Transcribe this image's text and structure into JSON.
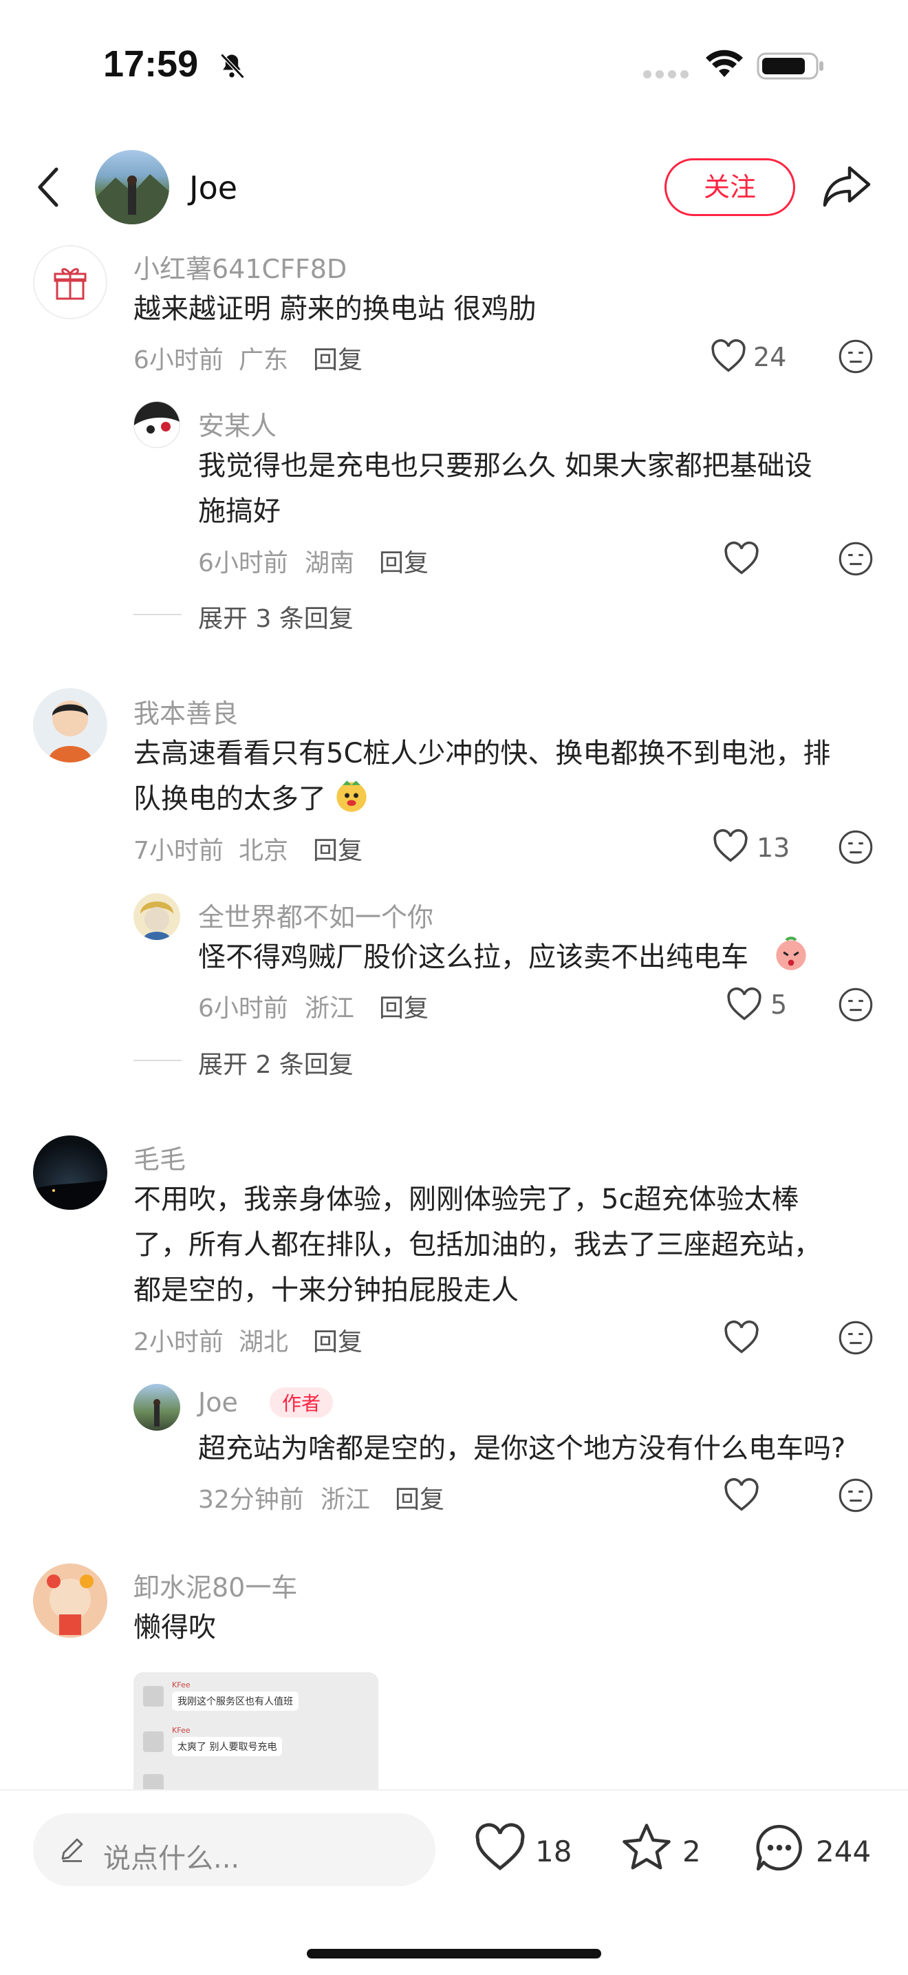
{
  "status": {
    "time": "17:59"
  },
  "header": {
    "name": "Joe",
    "follow_label": "关注"
  },
  "comments": [
    {
      "user": "小红薯641CFF8D",
      "text": "越来越证明 蔚来的换电站 很鸡肋",
      "time": "6小时前",
      "region": "广东",
      "reply_label": "回复",
      "likes": "24",
      "replies": [
        {
          "user": "安某人",
          "text_lines": [
            "我觉得也是充电也只要那么久   如果大家都把基础设",
            "施搞好"
          ],
          "time": "6小时前",
          "region": "湖南",
          "reply_label": "回复",
          "likes": ""
        }
      ],
      "expand": "展开 3 条回复"
    },
    {
      "user": "我本善良",
      "text_lines": [
        "去高速看看只有5C桩人少冲的快、换电都换不到电池，排",
        "队换电的太多了"
      ],
      "time": "7小时前",
      "region": "北京",
      "reply_label": "回复",
      "likes": "13",
      "replies": [
        {
          "user": "全世界都不如一个你",
          "text": "怪不得鸡贼厂股价这么拉，应该卖不出纯电车",
          "time": "6小时前",
          "region": "浙江",
          "reply_label": "回复",
          "likes": "5"
        }
      ],
      "expand": "展开 2 条回复"
    },
    {
      "user": "毛毛",
      "text_lines": [
        "不用吹，我亲身体验，刚刚体验完了，5c超充体验太棒",
        "了，所有人都在排队，包括加油的，我去了三座超充站，",
        "都是空的，十来分钟拍屁股走人"
      ],
      "time": "2小时前",
      "region": "湖北",
      "reply_label": "回复",
      "likes": "",
      "replies": [
        {
          "user": "Joe",
          "badge": "作者",
          "text": "超充站为啥都是空的，是你这个地方没有什么电车吗?",
          "time": "32分钟前",
          "region": "浙江",
          "reply_label": "回复",
          "likes": ""
        }
      ]
    },
    {
      "user": "卸水泥80一车",
      "text": "懒得吹",
      "image_lines": [
        "我刚这个服务区也有人值班",
        "太爽了 别人要取号充电"
      ],
      "image_user": "KFee"
    }
  ],
  "bottom": {
    "placeholder": "说点什么...",
    "likes": "18",
    "stars": "2",
    "comments": "244"
  },
  "colors": {
    "accent": "#ff2442",
    "meta": "#9a9a9a"
  }
}
